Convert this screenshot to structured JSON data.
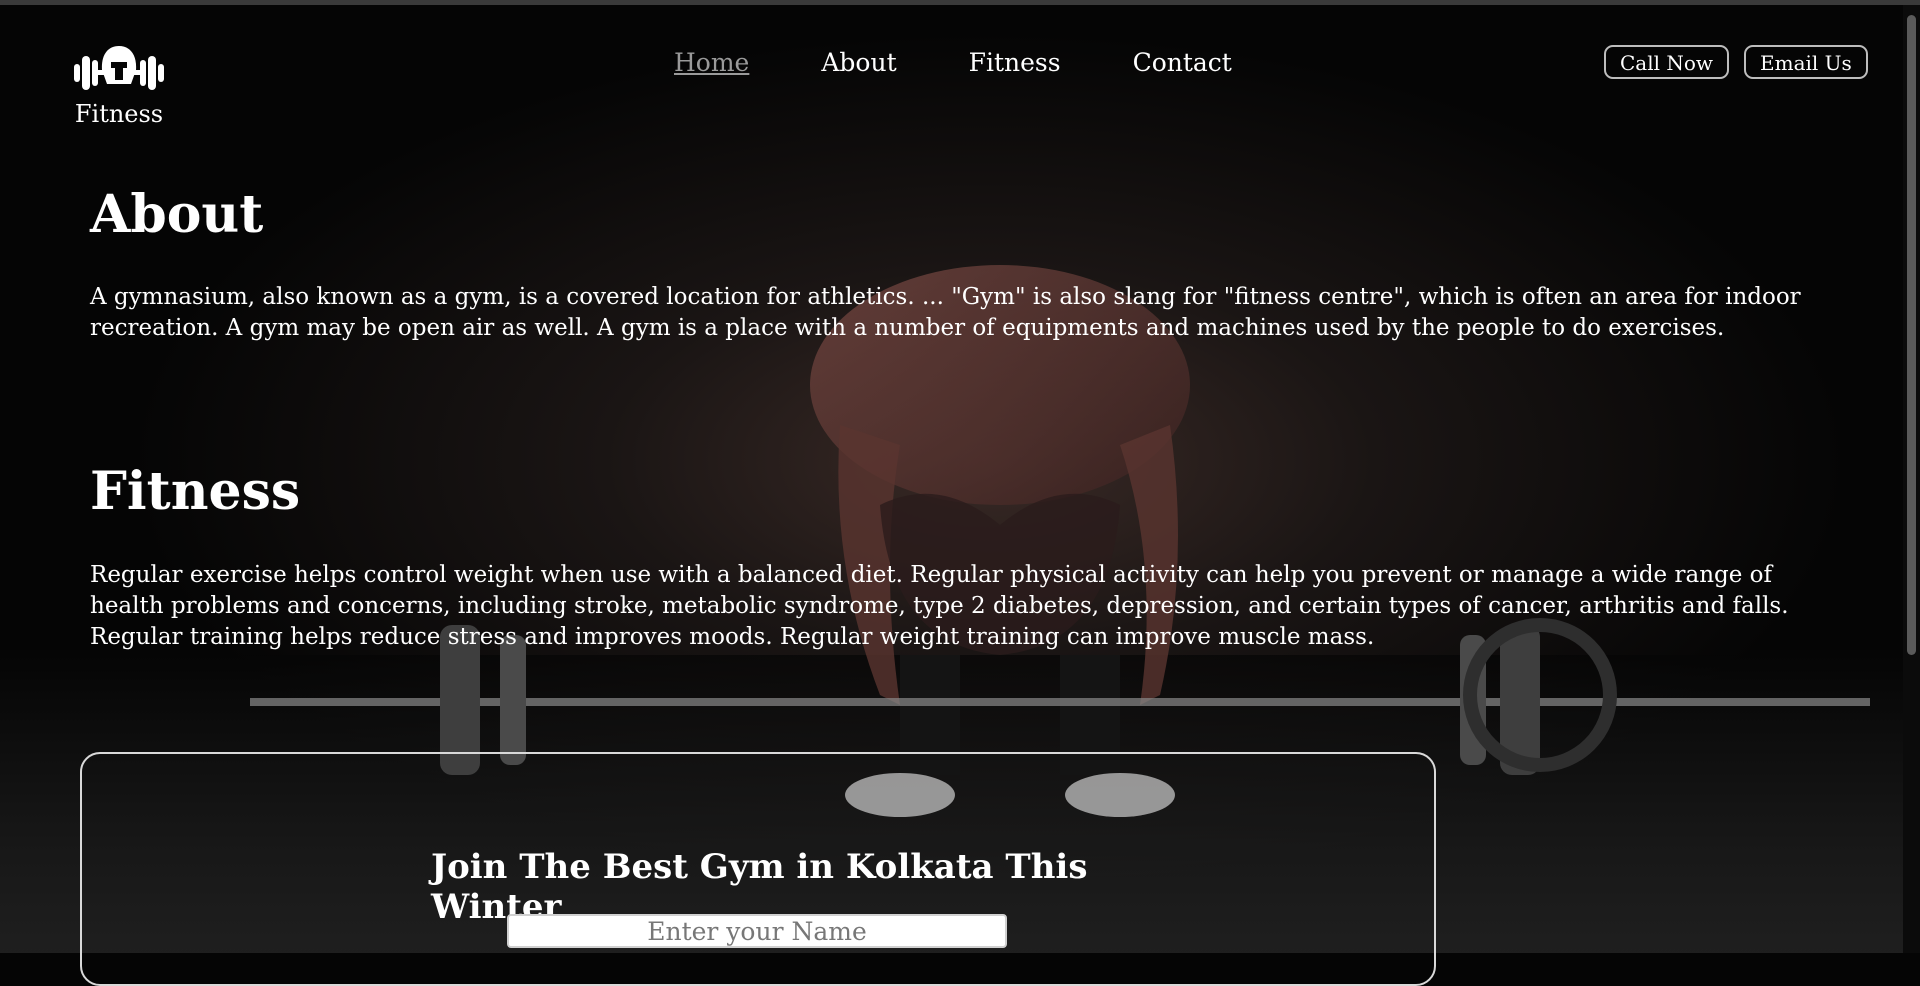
{
  "brand": {
    "name": "Fitness",
    "icon": "gym-helmet-dumbbell-icon"
  },
  "nav": {
    "items": [
      "Home",
      "About",
      "Fitness",
      "Contact"
    ],
    "active": "Home"
  },
  "actions": {
    "call_label": "Call Now",
    "email_label": "Email Us"
  },
  "about": {
    "title": "About",
    "body": "A gymnasium, also known as a gym, is a covered location for athletics. ... \"Gym\" is also slang for \"fitness centre\", which is often an area for indoor recreation. A gym may be open air as well. A gym is a place with a number of equipments and machines used by the people to do exercises."
  },
  "fitness": {
    "title": "Fitness",
    "body": "Regular exercise helps control weight when use with a balanced diet. Regular physical activity can help you prevent or manage a wide range of health problems and concerns, including stroke, metabolic syndrome, type 2 diabetes, depression, and certain types of cancer, arthritis and falls. Regular training helps reduce stress and improves moods. Regular weight training can improve muscle mass."
  },
  "join": {
    "title": "Join The Best Gym in Kolkata This Winter",
    "name_placeholder": "Enter your Name"
  },
  "colors": {
    "background": "#050505",
    "text": "#ffffff",
    "nav_active": "#9a9a9a"
  }
}
